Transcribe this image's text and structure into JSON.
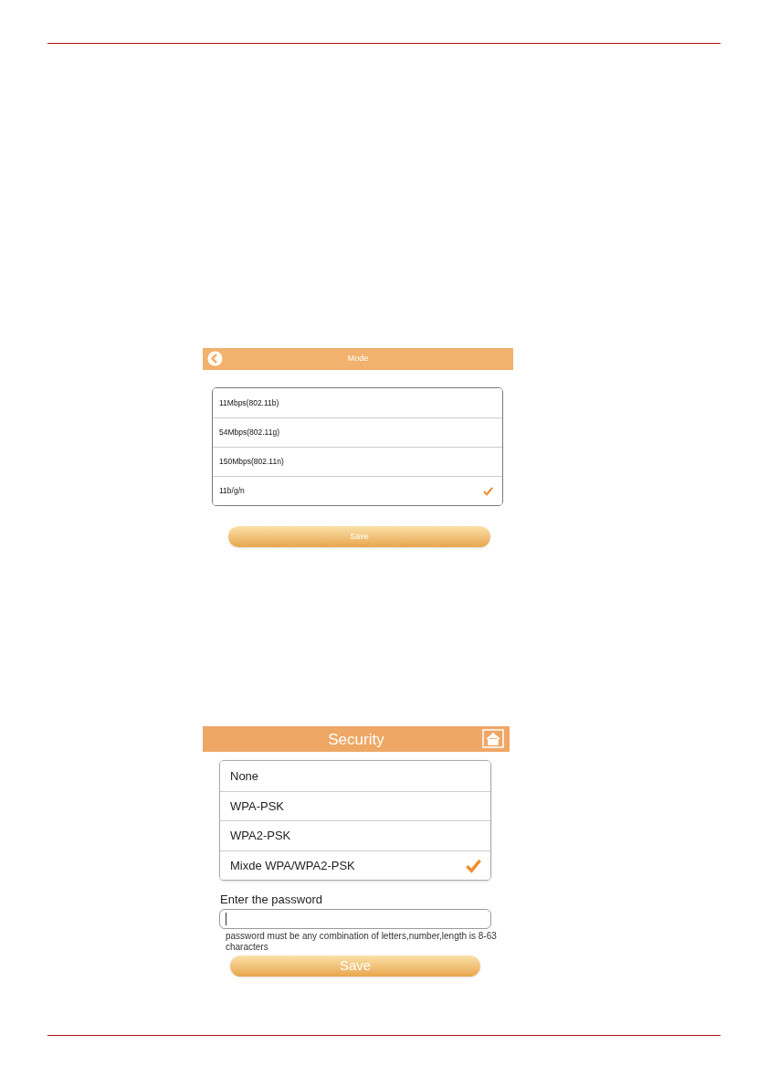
{
  "mode_screen": {
    "title": "Mode",
    "options": [
      {
        "label": "11Mbps(802.11b)",
        "selected": false
      },
      {
        "label": "54Mbps(802.11g)",
        "selected": false
      },
      {
        "label": "150Mbps(802.11n)",
        "selected": false
      },
      {
        "label": "11b/g/n",
        "selected": true
      }
    ],
    "save_button": "Save"
  },
  "security_screen": {
    "title": "Security",
    "options": [
      {
        "label": "None",
        "selected": false
      },
      {
        "label": "WPA-PSK",
        "selected": false
      },
      {
        "label": "WPA2-PSK",
        "selected": false
      },
      {
        "label": "Mixde WPA/WPA2-PSK",
        "selected": true
      }
    ],
    "password_label": "Enter the password",
    "hint": "password must be any combination of letters,number,length is 8-63 characters",
    "save_button": "Save"
  }
}
